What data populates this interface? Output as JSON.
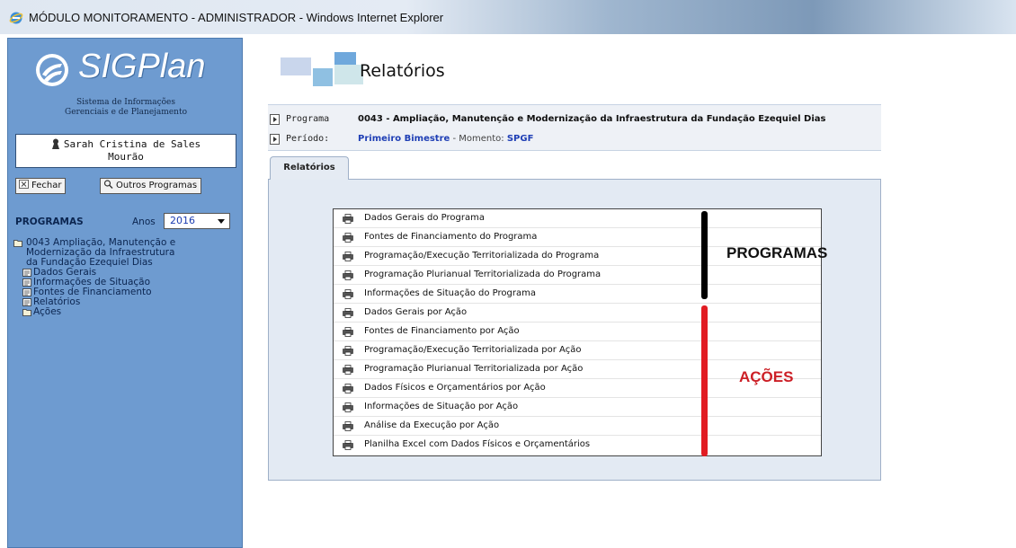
{
  "window": {
    "title": "MÓDULO MONITORAMENTO - ADMINISTRADOR - Windows Internet Explorer"
  },
  "sidebar": {
    "logo_text": "SIGPlan",
    "subtitle_line1": "Sistema de Informações",
    "subtitle_line2": "Gerenciais e de Planejamento",
    "user_line1": "Sarah Cristina de Sales",
    "user_line2": "Mourão",
    "fechar_label": "Fechar",
    "outros_label": "Outros Programas",
    "programas_label": "PROGRAMAS",
    "ano_label": "Anos",
    "ano_value": "2016",
    "tree": {
      "root_line1": "0043 Ampliação, Manutenção e",
      "root_line2": "Modernização da Infraestrutura",
      "root_line3": "da Fundação Ezequiel Dias",
      "children": [
        "Dados Gerais",
        "Informações de Situação",
        "Fontes de Financiamento",
        "Relatórios",
        "Ações"
      ]
    }
  },
  "main": {
    "page_title": "Relatórios",
    "programa_label": "Programa",
    "programa_value": "0043 - Ampliação, Manutenção e Modernização da Infraestrutura da Fundação Ezequiel Dias",
    "periodo_label": "Período:",
    "periodo_value": "Primeiro Bimestre",
    "momento_sep": " - Momento: ",
    "momento_value": "SPGF",
    "tab_label": "Relatórios",
    "reports": [
      "Dados Gerais do Programa",
      "Fontes de Financiamento do Programa",
      "Programação/Execução Territorializada do Programa",
      "Programação Plurianual Territorializada do Programa",
      "Informações de Situação do Programa",
      "Dados Gerais por Ação",
      "Fontes de Financiamento por Ação",
      "Programação/Execução Territorializada por Ação",
      "Programação Plurianual Territorializada por Ação",
      "Dados Físicos e Orçamentários por Ação",
      "Informações de Situação por Ação",
      "Análise da Execução por Ação",
      "Planilha Excel com Dados Físicos e Orçamentários"
    ],
    "annotation_programas": "PROGRAMAS",
    "annotation_acoes": "AÇÕES"
  },
  "colors": {
    "sidebar_bg": "#6e9bd0",
    "annotation_black": "#000000",
    "annotation_red": "#e11c23",
    "link_blue": "#1f3fb5"
  }
}
